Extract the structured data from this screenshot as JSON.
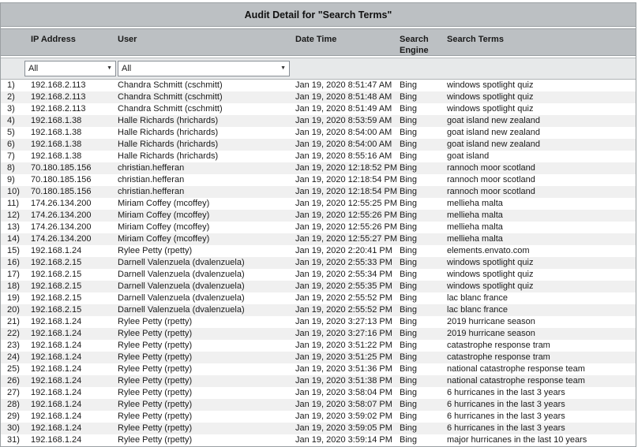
{
  "title": "Audit Detail for \"Search Terms\"",
  "columns": {
    "ip": "IP Address",
    "user": "User",
    "datetime": "Date Time",
    "engine": "Search Engine",
    "terms": "Search Terms"
  },
  "filters": {
    "ip_filter_value": "All",
    "user_filter_value": "All",
    "dropdown_arrow_icon": "▼"
  },
  "colors": {
    "band_gray": "#bcc0c3",
    "filter_band_gray": "#e7e9ea",
    "row_alt_gray": "#f0f0f0",
    "border_gray": "#9ba0a3"
  },
  "table": {
    "rows": [
      {
        "num": "1)",
        "ip": "192.168.2.113",
        "user": "Chandra Schmitt (cschmitt)",
        "datetime": "Jan 19, 2020 8:51:47 AM",
        "engine": "Bing",
        "terms": "windows spotlight quiz"
      },
      {
        "num": "2)",
        "ip": "192.168.2.113",
        "user": "Chandra Schmitt (cschmitt)",
        "datetime": "Jan 19, 2020 8:51:48 AM",
        "engine": "Bing",
        "terms": "windows spotlight quiz"
      },
      {
        "num": "3)",
        "ip": "192.168.2.113",
        "user": "Chandra Schmitt (cschmitt)",
        "datetime": "Jan 19, 2020 8:51:49 AM",
        "engine": "Bing",
        "terms": "windows spotlight quiz"
      },
      {
        "num": "4)",
        "ip": "192.168.1.38",
        "user": "Halle Richards (hrichards)",
        "datetime": "Jan 19, 2020 8:53:59 AM",
        "engine": "Bing",
        "terms": "goat island new zealand"
      },
      {
        "num": "5)",
        "ip": "192.168.1.38",
        "user": "Halle Richards (hrichards)",
        "datetime": "Jan 19, 2020 8:54:00 AM",
        "engine": "Bing",
        "terms": "goat island new zealand"
      },
      {
        "num": "6)",
        "ip": "192.168.1.38",
        "user": "Halle Richards (hrichards)",
        "datetime": "Jan 19, 2020 8:54:00 AM",
        "engine": "Bing",
        "terms": "goat island new zealand"
      },
      {
        "num": "7)",
        "ip": "192.168.1.38",
        "user": "Halle Richards (hrichards)",
        "datetime": "Jan 19, 2020 8:55:16 AM",
        "engine": "Bing",
        "terms": "goat island"
      },
      {
        "num": "8)",
        "ip": "70.180.185.156",
        "user": "christian.hefferan",
        "datetime": "Jan 19, 2020 12:18:52 PM",
        "engine": "Bing",
        "terms": "rannoch moor scotland"
      },
      {
        "num": "9)",
        "ip": "70.180.185.156",
        "user": "christian.hefferan",
        "datetime": "Jan 19, 2020 12:18:54 PM",
        "engine": "Bing",
        "terms": "rannoch moor scotland"
      },
      {
        "num": "10)",
        "ip": "70.180.185.156",
        "user": "christian.hefferan",
        "datetime": "Jan 19, 2020 12:18:54 PM",
        "engine": "Bing",
        "terms": "rannoch moor scotland"
      },
      {
        "num": "11)",
        "ip": "174.26.134.200",
        "user": "Miriam Coffey (mcoffey)",
        "datetime": "Jan 19, 2020 12:55:25 PM",
        "engine": "Bing",
        "terms": "mellieha malta"
      },
      {
        "num": "12)",
        "ip": "174.26.134.200",
        "user": "Miriam Coffey (mcoffey)",
        "datetime": "Jan 19, 2020 12:55:26 PM",
        "engine": "Bing",
        "terms": "mellieha malta"
      },
      {
        "num": "13)",
        "ip": "174.26.134.200",
        "user": "Miriam Coffey (mcoffey)",
        "datetime": "Jan 19, 2020 12:55:26 PM",
        "engine": "Bing",
        "terms": "mellieha malta"
      },
      {
        "num": "14)",
        "ip": "174.26.134.200",
        "user": "Miriam Coffey (mcoffey)",
        "datetime": "Jan 19, 2020 12:55:27 PM",
        "engine": "Bing",
        "terms": "mellieha malta"
      },
      {
        "num": "15)",
        "ip": "192.168.1.24",
        "user": "Rylee Petty (rpetty)",
        "datetime": "Jan 19, 2020 2:20:41 PM",
        "engine": "Bing",
        "terms": "elements.envato.com"
      },
      {
        "num": "16)",
        "ip": "192.168.2.15",
        "user": "Darnell Valenzuela (dvalenzuela)",
        "datetime": "Jan 19, 2020 2:55:33 PM",
        "engine": "Bing",
        "terms": "windows spotlight quiz"
      },
      {
        "num": "17)",
        "ip": "192.168.2.15",
        "user": "Darnell Valenzuela (dvalenzuela)",
        "datetime": "Jan 19, 2020 2:55:34 PM",
        "engine": "Bing",
        "terms": "windows spotlight quiz"
      },
      {
        "num": "18)",
        "ip": "192.168.2.15",
        "user": "Darnell Valenzuela (dvalenzuela)",
        "datetime": "Jan 19, 2020 2:55:35 PM",
        "engine": "Bing",
        "terms": "windows spotlight quiz"
      },
      {
        "num": "19)",
        "ip": "192.168.2.15",
        "user": "Darnell Valenzuela (dvalenzuela)",
        "datetime": "Jan 19, 2020 2:55:52 PM",
        "engine": "Bing",
        "terms": "lac blanc france"
      },
      {
        "num": "20)",
        "ip": "192.168.2.15",
        "user": "Darnell Valenzuela (dvalenzuela)",
        "datetime": "Jan 19, 2020 2:55:52 PM",
        "engine": "Bing",
        "terms": "lac blanc france"
      },
      {
        "num": "21)",
        "ip": "192.168.1.24",
        "user": "Rylee Petty (rpetty)",
        "datetime": "Jan 19, 2020 3:27:13 PM",
        "engine": "Bing",
        "terms": "2019 hurricane season"
      },
      {
        "num": "22)",
        "ip": "192.168.1.24",
        "user": "Rylee Petty (rpetty)",
        "datetime": "Jan 19, 2020 3:27:16 PM",
        "engine": "Bing",
        "terms": "2019 hurricane season"
      },
      {
        "num": "23)",
        "ip": "192.168.1.24",
        "user": "Rylee Petty (rpetty)",
        "datetime": "Jan 19, 2020 3:51:22 PM",
        "engine": "Bing",
        "terms": "catastrophe response tram"
      },
      {
        "num": "24)",
        "ip": "192.168.1.24",
        "user": "Rylee Petty (rpetty)",
        "datetime": "Jan 19, 2020 3:51:25 PM",
        "engine": "Bing",
        "terms": "catastrophe response tram"
      },
      {
        "num": "25)",
        "ip": "192.168.1.24",
        "user": "Rylee Petty (rpetty)",
        "datetime": "Jan 19, 2020 3:51:36 PM",
        "engine": "Bing",
        "terms": "national catastrophe response team"
      },
      {
        "num": "26)",
        "ip": "192.168.1.24",
        "user": "Rylee Petty (rpetty)",
        "datetime": "Jan 19, 2020 3:51:38 PM",
        "engine": "Bing",
        "terms": "national catastrophe response team"
      },
      {
        "num": "27)",
        "ip": "192.168.1.24",
        "user": "Rylee Petty (rpetty)",
        "datetime": "Jan 19, 2020 3:58:04 PM",
        "engine": "Bing",
        "terms": "6 hurricanes in the last 3 years"
      },
      {
        "num": "28)",
        "ip": "192.168.1.24",
        "user": "Rylee Petty (rpetty)",
        "datetime": "Jan 19, 2020 3:58:07 PM",
        "engine": "Bing",
        "terms": "6 hurricanes in the last 3 years"
      },
      {
        "num": "29)",
        "ip": "192.168.1.24",
        "user": "Rylee Petty (rpetty)",
        "datetime": "Jan 19, 2020 3:59:02 PM",
        "engine": "Bing",
        "terms": "6 hurricanes in the last 3 years"
      },
      {
        "num": "30)",
        "ip": "192.168.1.24",
        "user": "Rylee Petty (rpetty)",
        "datetime": "Jan 19, 2020 3:59:05 PM",
        "engine": "Bing",
        "terms": "6 hurricanes in the last 3 years"
      },
      {
        "num": "31)",
        "ip": "192.168.1.24",
        "user": "Rylee Petty (rpetty)",
        "datetime": "Jan 19, 2020 3:59:14 PM",
        "engine": "Bing",
        "terms": "major hurricanes in the last 10 years"
      }
    ]
  }
}
